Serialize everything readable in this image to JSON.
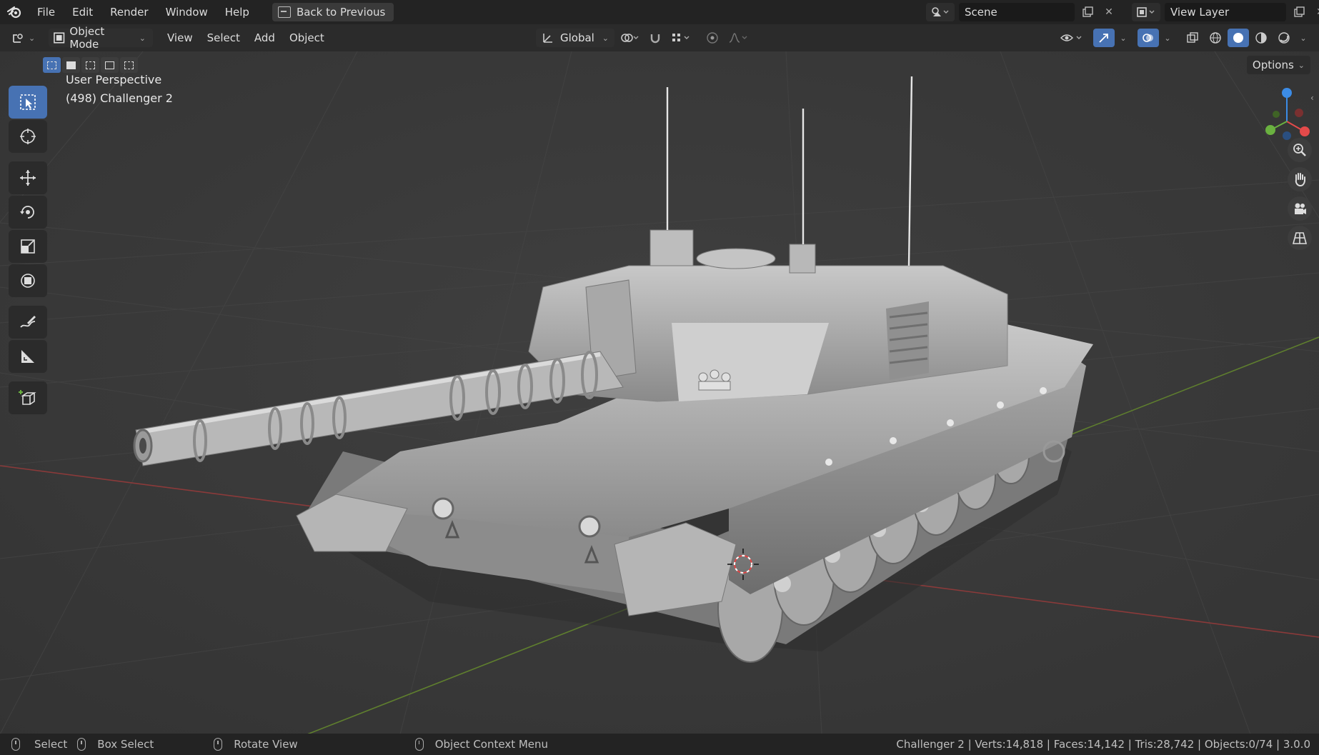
{
  "topbar": {
    "menu": [
      "File",
      "Edit",
      "Render",
      "Window",
      "Help"
    ],
    "back_label": "Back to Previous",
    "scene_name": "Scene",
    "view_layer": "View Layer"
  },
  "header": {
    "mode_label": "Object Mode",
    "menus": [
      "View",
      "Select",
      "Add",
      "Object"
    ],
    "orientation_label": "Global"
  },
  "options_label": "Options",
  "viewport": {
    "perspective_label": "User Perspective",
    "object_label": "(498) Challenger 2"
  },
  "statusbar": {
    "select_label": "Select",
    "box_select_label": "Box Select",
    "rotate_label": "Rotate View",
    "context_label": "Object Context Menu",
    "stats": "Challenger 2 | Verts:14,818 | Faces:14,142 | Tris:28,742 | Objects:0/74 | 3.0.0"
  },
  "colors": {
    "accent": "#4772b3",
    "x_axis": "#a33c3c",
    "y_axis": "#6a8f2e",
    "gizmo_x": "#e44a4a",
    "gizmo_y": "#6ab140",
    "gizmo_z": "#3c8ce6"
  }
}
